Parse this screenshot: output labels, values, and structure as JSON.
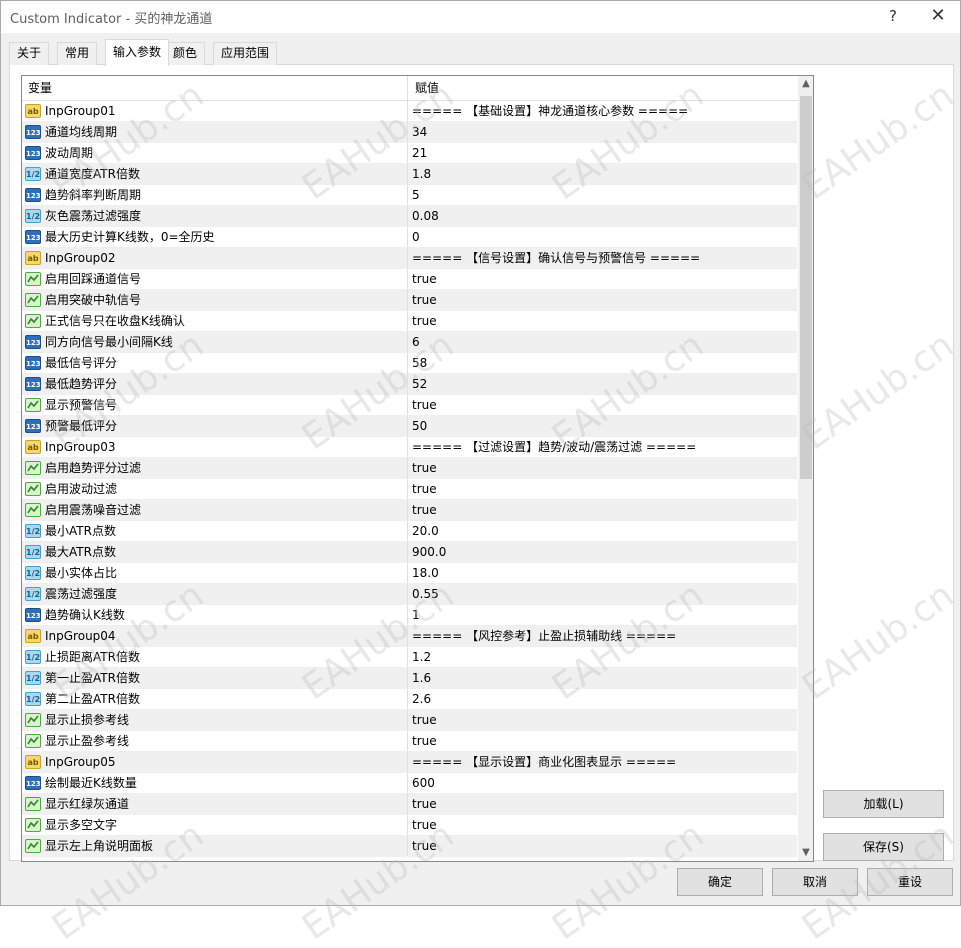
{
  "window": {
    "title": "Custom Indicator - 买的神龙通道",
    "help_glyph": "?",
    "close_glyph": "✕"
  },
  "tabs": [
    {
      "label": "关于",
      "active": false
    },
    {
      "label": "常用",
      "active": false
    },
    {
      "label": "输入参数",
      "active": true
    },
    {
      "label": "颜色",
      "active": false
    },
    {
      "label": "应用范围",
      "active": false
    }
  ],
  "grid": {
    "col_variable": "变量",
    "col_value": "赋值",
    "rows": [
      {
        "type": "string",
        "name": "InpGroup01",
        "value": "===== 【基础设置】神龙通道核心参数 ====="
      },
      {
        "type": "int",
        "name": "通道均线周期",
        "value": "34"
      },
      {
        "type": "int",
        "name": "波动周期",
        "value": "21"
      },
      {
        "type": "double",
        "name": "通道宽度ATR倍数",
        "value": "1.8"
      },
      {
        "type": "int",
        "name": "趋势斜率判断周期",
        "value": "5"
      },
      {
        "type": "double",
        "name": "灰色震荡过滤强度",
        "value": "0.08"
      },
      {
        "type": "int",
        "name": "最大历史计算K线数，0=全历史",
        "value": "0"
      },
      {
        "type": "string",
        "name": "InpGroup02",
        "value": "===== 【信号设置】确认信号与预警信号 ====="
      },
      {
        "type": "bool",
        "name": "启用回踩通道信号",
        "value": "true"
      },
      {
        "type": "bool",
        "name": "启用突破中轨信号",
        "value": "true"
      },
      {
        "type": "bool",
        "name": "正式信号只在收盘K线确认",
        "value": "true"
      },
      {
        "type": "int",
        "name": "同方向信号最小间隔K线",
        "value": "6"
      },
      {
        "type": "int",
        "name": "最低信号评分",
        "value": "58"
      },
      {
        "type": "int",
        "name": "最低趋势评分",
        "value": "52"
      },
      {
        "type": "bool",
        "name": "显示预警信号",
        "value": "true"
      },
      {
        "type": "int",
        "name": "预警最低评分",
        "value": "50"
      },
      {
        "type": "string",
        "name": "InpGroup03",
        "value": "===== 【过滤设置】趋势/波动/震荡过滤 ====="
      },
      {
        "type": "bool",
        "name": "启用趋势评分过滤",
        "value": "true"
      },
      {
        "type": "bool",
        "name": "启用波动过滤",
        "value": "true"
      },
      {
        "type": "bool",
        "name": "启用震荡噪音过滤",
        "value": "true"
      },
      {
        "type": "double",
        "name": "最小ATR点数",
        "value": "20.0"
      },
      {
        "type": "double",
        "name": "最大ATR点数",
        "value": "900.0"
      },
      {
        "type": "double",
        "name": "最小实体占比",
        "value": "18.0"
      },
      {
        "type": "double",
        "name": "震荡过滤强度",
        "value": "0.55"
      },
      {
        "type": "int",
        "name": "趋势确认K线数",
        "value": "1"
      },
      {
        "type": "string",
        "name": "InpGroup04",
        "value": "===== 【风控参考】止盈止损辅助线 ====="
      },
      {
        "type": "double",
        "name": "止损距离ATR倍数",
        "value": "1.2"
      },
      {
        "type": "double",
        "name": "第一止盈ATR倍数",
        "value": "1.6"
      },
      {
        "type": "double",
        "name": "第二止盈ATR倍数",
        "value": "2.6"
      },
      {
        "type": "bool",
        "name": "显示止损参考线",
        "value": "true"
      },
      {
        "type": "bool",
        "name": "显示止盈参考线",
        "value": "true"
      },
      {
        "type": "string",
        "name": "InpGroup05",
        "value": "===== 【显示设置】商业化图表显示 ====="
      },
      {
        "type": "int",
        "name": "绘制最近K线数量",
        "value": "600"
      },
      {
        "type": "bool",
        "name": "显示红绿灰通道",
        "value": "true"
      },
      {
        "type": "bool",
        "name": "显示多空文字",
        "value": "true"
      },
      {
        "type": "bool",
        "name": "显示左上角说明面板",
        "value": "true"
      }
    ]
  },
  "icons": {
    "string": "ab",
    "int": "123",
    "double": "1/2"
  },
  "buttons": {
    "load": "加载(L)",
    "save": "保存(S)",
    "ok": "确定",
    "cancel": "取消",
    "reset": "重设"
  },
  "scrollbar": {
    "up": "▲",
    "down": "▼"
  },
  "watermark_text": "EAHub.cn"
}
